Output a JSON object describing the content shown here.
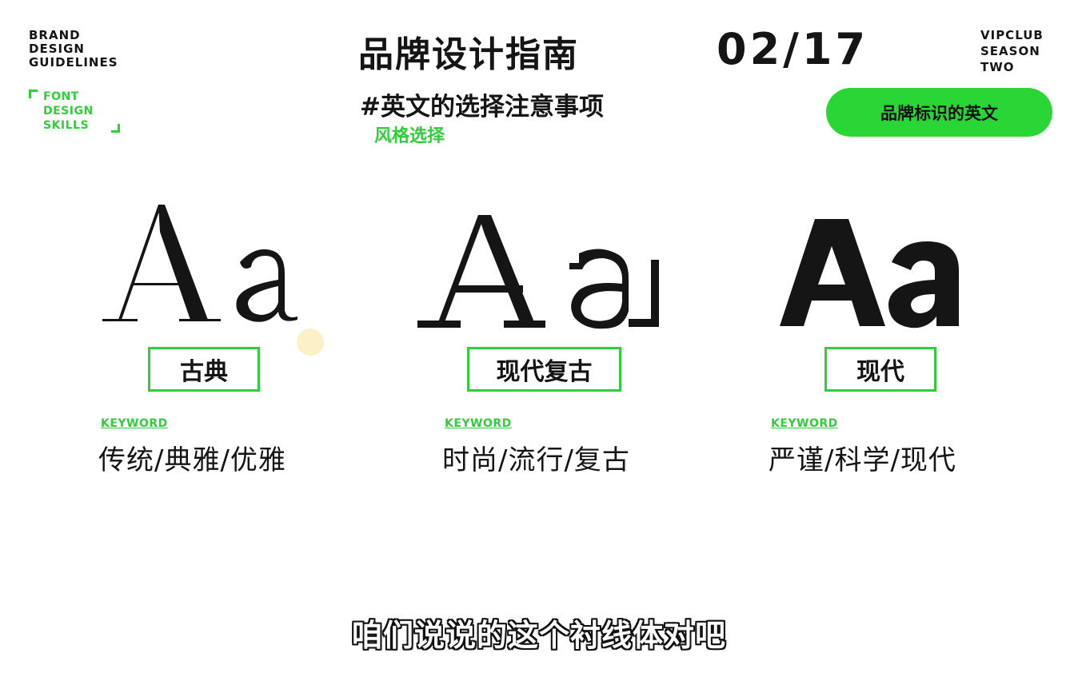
{
  "brand": {
    "lines": [
      "BRAND",
      "DESIGN",
      "GUIDELINES"
    ]
  },
  "font_skills": {
    "lines": [
      "FONT",
      "DESIGN",
      "SKILLS"
    ]
  },
  "header": {
    "title": "品牌设计指南",
    "page": "02/17",
    "vip_lines": [
      "VIPCLUB",
      "SEASON",
      "TWO"
    ]
  },
  "subtitle": "#英文的选择注意事项",
  "subtitle_green": "风格选择",
  "pill_label": "品牌标识的英文",
  "columns": [
    {
      "specimen": "Aa",
      "label": "古典",
      "keyword": "KEYWORD",
      "keywords_text": "传统/典雅/优雅"
    },
    {
      "specimen": "Aa",
      "label": "现代复古",
      "keyword": "KEYWORD",
      "keywords_text": "时尚/流行/复古"
    },
    {
      "specimen": "Aa",
      "label": "现代",
      "keyword": "KEYWORD",
      "keywords_text": "严谨/科学/现代"
    }
  ],
  "caption": "咱们说说的这个衬线体对吧",
  "colors": {
    "accent": "#2fcf3a",
    "pill": "#2ad636",
    "text": "#151515",
    "dot": "#fbf0c8"
  }
}
